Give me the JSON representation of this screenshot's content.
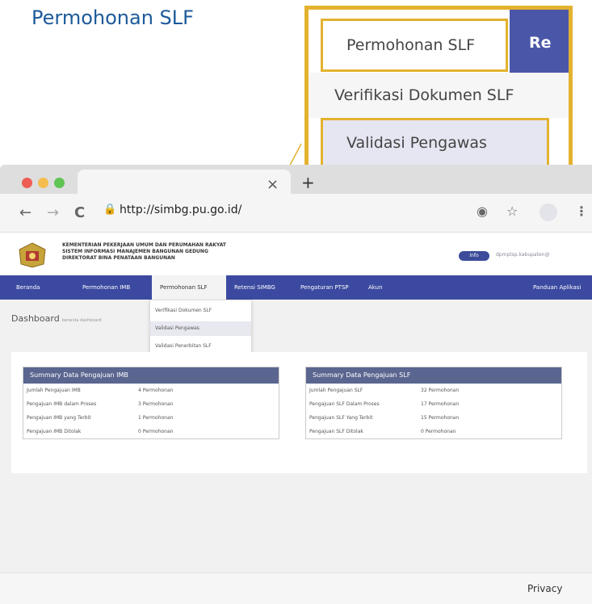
{
  "heading": "Permohonan SLF",
  "zoom": {
    "item1": "Permohonan SLF",
    "item1_next": "Re",
    "item2": "Verifikasi Dokumen SLF",
    "item3": "Validasi Pengawas"
  },
  "browser": {
    "close": "×",
    "newtab": "+",
    "back": "←",
    "forward": "→",
    "reload": "C",
    "url": "http://simbg.pu.go.id/",
    "menu": "⋮",
    "star": "☆",
    "ext": "◉"
  },
  "site": {
    "org_lines": [
      "KEMENTERIAN PEKERJAAN UMUM DAN PERUMAHAN RAKYAT",
      "SISTEM INFORMASI MANAJEMEN BANGUNAN GEDUNG",
      "DIREKTORAT BINA PENATAAN BANGUNAN"
    ],
    "user_badge": "Info",
    "user_email": "dpmptsp.kabupaten@"
  },
  "nav": [
    "Beranda",
    "Permohonan IMB",
    "Permohonan SLF",
    "Retensi SIMBG",
    "Pengaturan PTSP",
    "Akun",
    "Panduan Aplikasi"
  ],
  "dropdown": [
    "Verifikasi Dokumen SLF",
    "Validasi Pengawas",
    "Validasi Penerbitan SLF"
  ],
  "dashboard": {
    "title": "Dashboard",
    "subtitle": "beranda dashboard"
  },
  "panel_imb": {
    "title": "Summary Data Pengajuan IMB",
    "rows": [
      {
        "label": "Jumlah Pengajuan IMB",
        "value": "4 Permohonan"
      },
      {
        "label": "Pengajuan IMB dalam Proses",
        "value": "3 Permohonan"
      },
      {
        "label": "Pengajuan IMB yang Terbit",
        "value": "1 Permohonan"
      },
      {
        "label": "Pengajuan IMB Ditolak",
        "value": "0 Permohonan"
      }
    ]
  },
  "panel_slf": {
    "title": "Summary Data Pengajuan SLF",
    "rows": [
      {
        "label": "Jumlah Pengajuan SLF",
        "value": "32 Permohonan"
      },
      {
        "label": "Pengajuan SLF Dalam Proses",
        "value": "17 Permohonan"
      },
      {
        "label": "Pengajuan SLF Yang Terbit",
        "value": "15 Permohonan"
      },
      {
        "label": "Pengajuan SLF Ditolak",
        "value": "0 Permohonan"
      }
    ]
  },
  "footer": {
    "privacy": "Privacy"
  },
  "colors": {
    "accent": "#e3b22f",
    "nav": "#3b4aa0",
    "title": "#1c5a9a"
  }
}
